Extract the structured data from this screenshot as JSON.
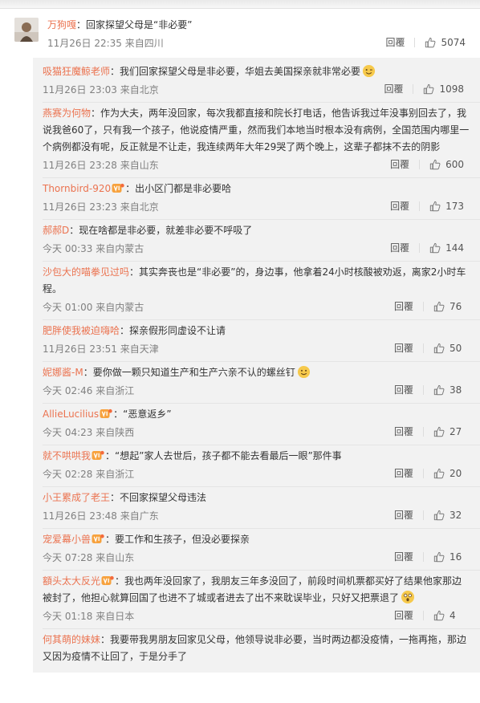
{
  "main_comment": {
    "username": "万狗嘎",
    "text": "：回家探望父母是“非必要”",
    "time": "11月26日 22:35 来自四川",
    "reply_label": "回覆",
    "likes": "5074"
  },
  "replies": [
    {
      "username": "吸猫狂魔鲸老师",
      "text": "：我们回家探望父母是非必要，华姐去美国探亲就非常必要",
      "time": "11月26日 23:03 来自北京",
      "reply_label": "回覆",
      "likes": "1098",
      "emoji_after": "wink-emoji"
    },
    {
      "username": "燕赛为何物",
      "text": "：作为大夫，两年没回家，每次我都直接和院长打电话，他告诉我过年没事别回去了，我说我爸60了，只有我一个孩子，他说疫情严重，然而我们本地当时根本没有病例，全国范围内哪里一个病例都没有呢，反正就是不让走，我连续两年大年29哭了两个晚上，这辈子都抹不去的阴影",
      "time": "11月26日 23:28 来自山东",
      "reply_label": "回覆",
      "likes": "600"
    },
    {
      "username": "Thornbird-920",
      "badge": "vip-badge",
      "text": "：出小区门都是非必要哈",
      "time": "11月26日 23:23 来自北京",
      "reply_label": "回覆",
      "likes": "173"
    },
    {
      "username": "郝郝D",
      "text": "：现在啥都是非必要，就差非必要不呼吸了",
      "time": "今天 00:33 来自内蒙古",
      "reply_label": "回覆",
      "likes": "144"
    },
    {
      "username": "沙包大的喵拳见过吗",
      "text": "：其实奔丧也是“非必要”的，身边事，他拿着24小时核酸被劝返，离家2小时车程。",
      "time": "今天 01:00 来自内蒙古",
      "reply_label": "回覆",
      "likes": "76"
    },
    {
      "username": "肥胖使我被迫嗨哈",
      "text": "：探亲假形同虚设不让请",
      "time": "11月26日 23:51 来自天津",
      "reply_label": "回覆",
      "likes": "50"
    },
    {
      "username": "妮娜酱-M",
      "text": "：要你做一颗只知道生产和生产六亲不认的螺丝钉",
      "time": "今天 02:46 来自浙江",
      "reply_label": "回覆",
      "likes": "38",
      "emoji_after": "smile-emoji"
    },
    {
      "username": "AllieLucilius",
      "badge": "vip-badge",
      "text": "：“恶意返乡”",
      "time": "今天 04:23 来自陕西",
      "reply_label": "回覆",
      "likes": "27"
    },
    {
      "username": "就不哄哄我",
      "badge": "vip-badge",
      "text": "：“想起”家人去世后，孩子都不能去看最后一眼”那件事",
      "time": "今天 02:28 来自浙江",
      "reply_label": "回覆",
      "likes": "20"
    },
    {
      "username": "小王累成了老王",
      "text": "：不回家探望父母违法",
      "time": "11月26日 23:48 来自广东",
      "reply_label": "回覆",
      "likes": "32"
    },
    {
      "username": "宠爱幕小兽",
      "badge": "vip-badge",
      "text": "：要工作和生孩子，但没必要探亲",
      "time": "今天 07:28 来自山东",
      "reply_label": "回覆",
      "likes": "16"
    },
    {
      "username": "額头太大反光",
      "badge": "vip-badge",
      "text": "：我也两年没回家了，我朋友三年多没回了，前段时间机票都买好了结果他家那边被封了，他担心就算回国了也进不了城或者进去了出不来耽误毕业，只好又把票退了",
      "time": "今天 01:18 来自日本",
      "reply_label": "回覆",
      "likes": "4",
      "emoji_after": "shocked-emoji"
    },
    {
      "username": "何其萌的妹妹",
      "text": "：我要带我男朋友回家见父母，他领导说非必要，当时两边都没疫情，一拖再拖，那边又因为疫情不让回了，于是分手了",
      "time": "",
      "reply_label": "",
      "likes": ""
    }
  ]
}
